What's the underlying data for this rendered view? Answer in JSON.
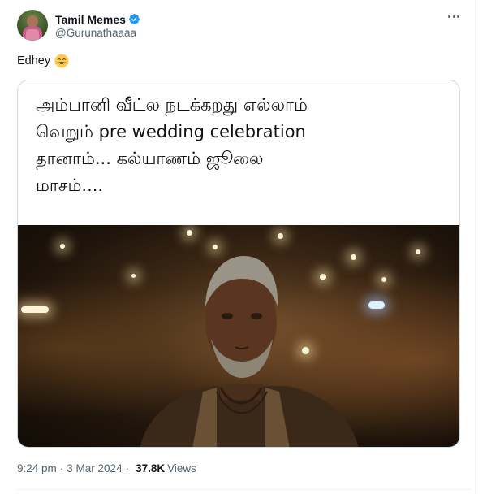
{
  "author": {
    "display_name": "Tamil Memes",
    "handle": "@Gurunathaaaa",
    "verified": true,
    "verified_color": "#1d9bf0"
  },
  "tweet": {
    "text": "Edhey",
    "emoji": "grinning-face-with-smiling-eyes"
  },
  "card": {
    "lines": [
      "அம்பானி வீட்ல நடக்கறது எல்லாம்",
      "வெறும் pre wedding celebration",
      "தானாம்... கல்யாணம் ஜூலை",
      "மாசம்...."
    ],
    "image": "man-in-dim-warehouse-photo"
  },
  "meta": {
    "time": "9:24 pm",
    "separator": "·",
    "date": "3 Mar 2024",
    "views_count": "37.8K",
    "views_label": "Views"
  },
  "colors": {
    "text_primary": "#0f1419",
    "text_secondary": "#536471",
    "border": "#cfd9de"
  }
}
